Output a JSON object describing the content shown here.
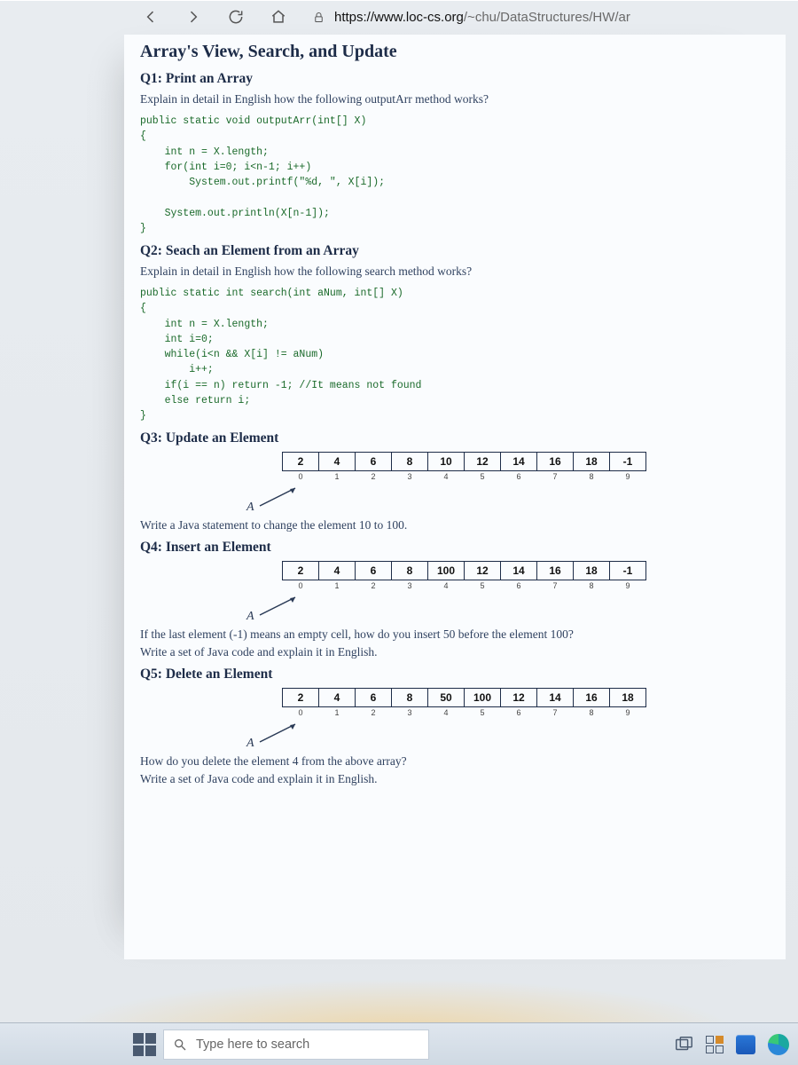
{
  "url": {
    "host": "https://www.loc-cs.org",
    "path": "/~chu/DataStructures/HW/ar"
  },
  "page": {
    "title": "Array's View, Search, and Update",
    "q1": {
      "heading": "Q1: Print an Array",
      "prompt": "Explain in detail in English how the following outputArr method works?",
      "code": "public static void outputArr(int[] X)\n{\n    int n = X.length;\n    for(int i=0; i<n-1; i++)\n        System.out.printf(\"%d, \", X[i]);\n\n    System.out.println(X[n-1]);\n}"
    },
    "q2": {
      "heading": "Q2: Seach an Element from an Array",
      "prompt": "Explain in detail in English how the following search method works?",
      "code": "public static int search(int aNum, int[] X)\n{\n    int n = X.length;\n    int i=0;\n    while(i<n && X[i] != aNum)\n        i++;\n    if(i == n) return -1; //It means not found\n    else return i;\n}"
    },
    "q3": {
      "heading": "Q3: Update an Element",
      "values": [
        "2",
        "4",
        "6",
        "8",
        "10",
        "12",
        "14",
        "16",
        "18",
        "-1"
      ],
      "indices": [
        "0",
        "1",
        "2",
        "3",
        "4",
        "5",
        "6",
        "7",
        "8",
        "9"
      ],
      "label": "A",
      "followup": "Write a Java statement to change the element 10 to 100."
    },
    "q4": {
      "heading": "Q4: Insert an Element",
      "values": [
        "2",
        "4",
        "6",
        "8",
        "100",
        "12",
        "14",
        "16",
        "18",
        "-1"
      ],
      "indices": [
        "0",
        "1",
        "2",
        "3",
        "4",
        "5",
        "6",
        "7",
        "8",
        "9"
      ],
      "label": "A",
      "followup1": "If the last element (-1) means an empty cell, how do you insert 50 before the element 100?",
      "followup2": "Write a set of Java code and explain it in English."
    },
    "q5": {
      "heading": "Q5: Delete an Element",
      "values": [
        "2",
        "4",
        "6",
        "8",
        "50",
        "100",
        "12",
        "14",
        "16",
        "18"
      ],
      "indices": [
        "0",
        "1",
        "2",
        "3",
        "4",
        "5",
        "6",
        "7",
        "8",
        "9"
      ],
      "label": "A",
      "followup1": "How do you delete the element 4 from the above array?",
      "followup2": "Write a set of Java code and explain it in English."
    }
  },
  "taskbar": {
    "search_placeholder": "Type here to search"
  }
}
